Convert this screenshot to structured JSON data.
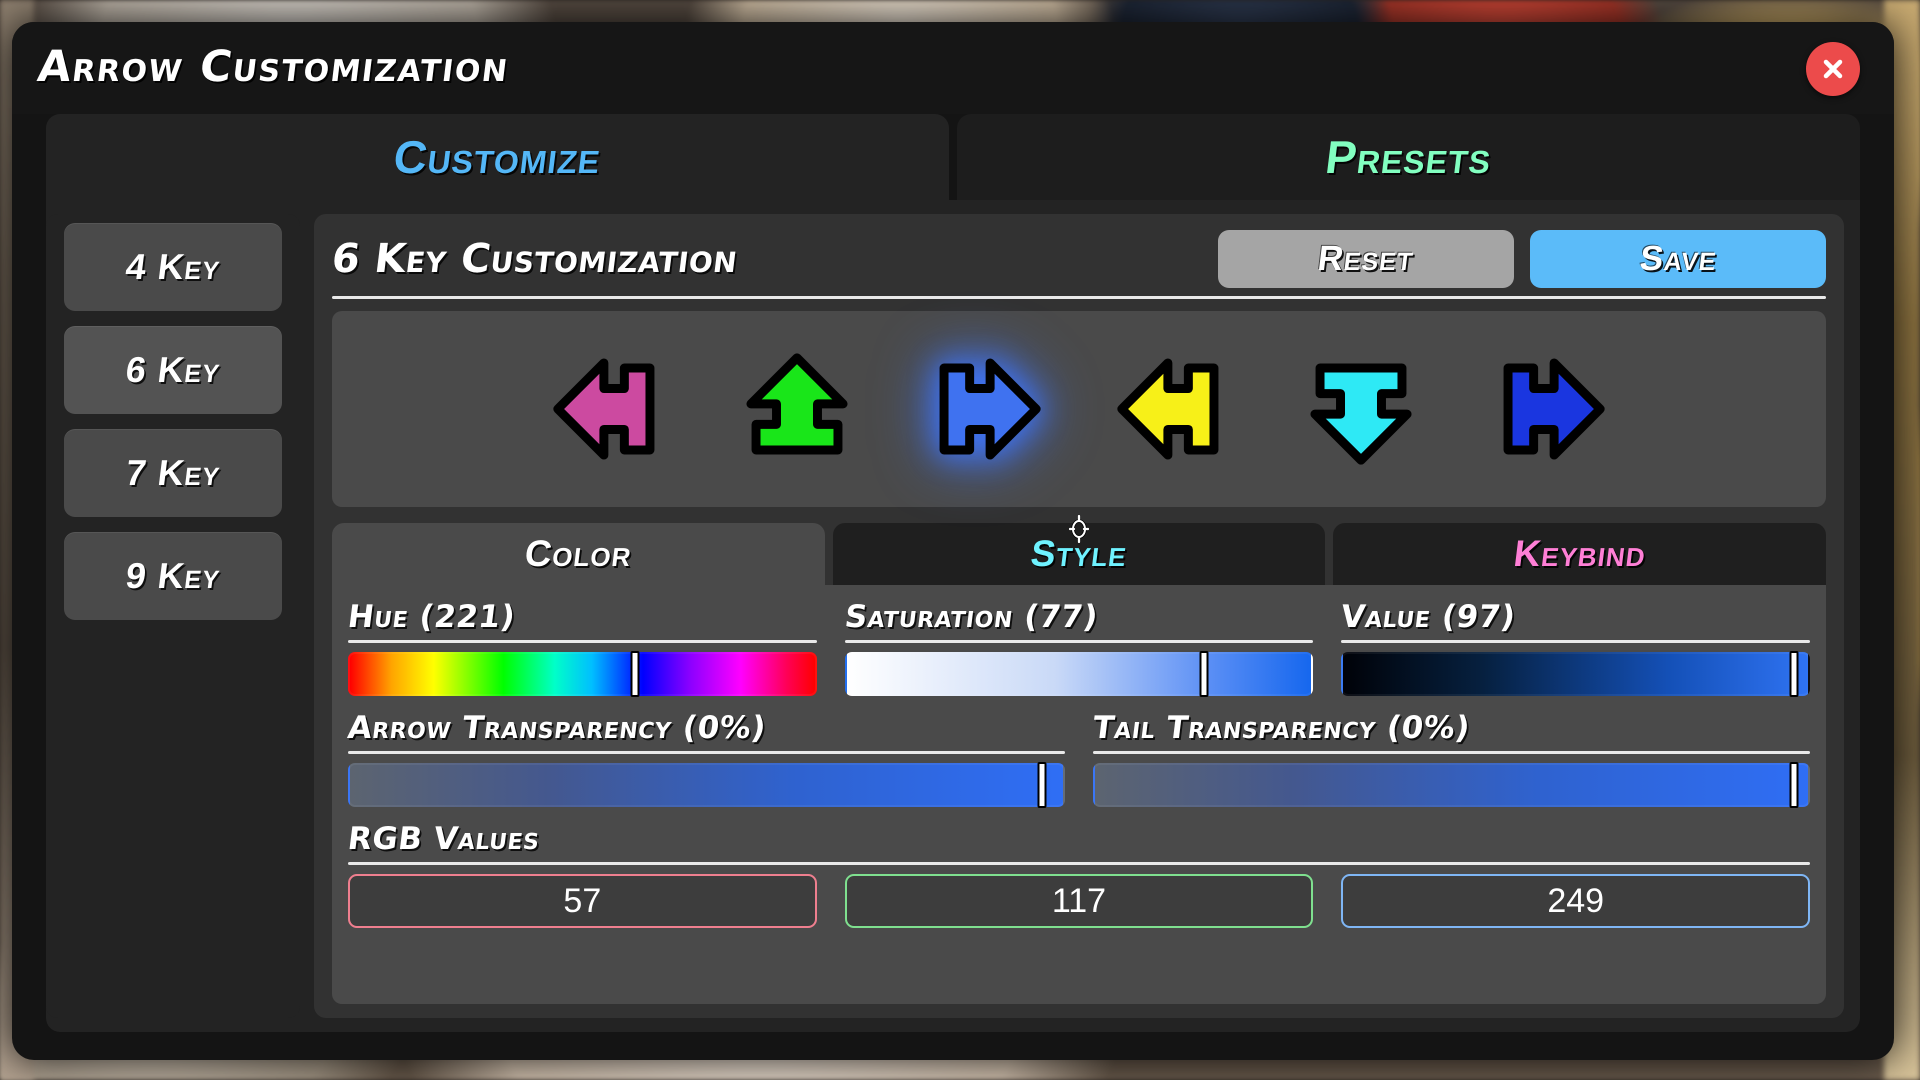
{
  "window": {
    "title": "Arrow Customization",
    "close_icon": "close-x-icon"
  },
  "top_tabs": [
    {
      "id": "customize",
      "label": "Customize",
      "color": "#54b7f7",
      "active": true
    },
    {
      "id": "presets",
      "label": "Presets",
      "color": "#82ffc0",
      "active": false
    }
  ],
  "sidebar": {
    "items": [
      {
        "label": "4 Key",
        "selected": false
      },
      {
        "label": "6 Key",
        "selected": true
      },
      {
        "label": "7 Key",
        "selected": false
      },
      {
        "label": "9 Key",
        "selected": false
      }
    ]
  },
  "panel": {
    "title": "6 Key Customization",
    "reset_label": "Reset",
    "save_label": "Save",
    "reset_color": "#a5a5a5",
    "save_color": "#5bbbf9"
  },
  "preview": {
    "arrows": [
      {
        "name": "arrow-left-magenta",
        "direction": "left",
        "color": "#cc4aa0",
        "selected": false
      },
      {
        "name": "arrow-up-green",
        "direction": "up",
        "color": "#19e619",
        "selected": false
      },
      {
        "name": "arrow-right-blue",
        "direction": "right",
        "color": "#3f72f0",
        "selected": true
      },
      {
        "name": "arrow-left-yellow",
        "direction": "left",
        "color": "#f7f018",
        "selected": false
      },
      {
        "name": "arrow-down-cyan",
        "direction": "down",
        "color": "#2ee9f5",
        "selected": false
      },
      {
        "name": "arrow-right-navy",
        "direction": "right",
        "color": "#1a36e0",
        "selected": false
      }
    ],
    "cursor_icon": "mouse-cursor-icon"
  },
  "sub_tabs": [
    {
      "id": "color",
      "label": "Color",
      "color": "#ffffff",
      "active": true
    },
    {
      "id": "style",
      "label": "Style",
      "color": "#6ff2ff",
      "active": false
    },
    {
      "id": "keybind",
      "label": "Keybind",
      "color": "#ff7fd6",
      "active": false
    }
  ],
  "sliders": {
    "hue": {
      "label": "Hue (221)",
      "value": 221,
      "max": 360,
      "percent": 61.4
    },
    "saturation": {
      "label": "Saturation (77)",
      "value": 77,
      "max": 100,
      "percent": 77
    },
    "value": {
      "label": "Value (97)",
      "value": 97,
      "max": 100,
      "percent": 97
    },
    "arrow_transparency": {
      "label": "Arrow Transparency (0%)",
      "value": 0,
      "max": 100,
      "percent": 97
    },
    "tail_transparency": {
      "label": "Tail Transparency (0%)",
      "value": 0,
      "max": 100,
      "percent": 98
    }
  },
  "rgb": {
    "label": "RGB Values",
    "r": "57",
    "g": "117",
    "b": "249",
    "r_border": "#ef7f8f",
    "g_border": "#7fe08f",
    "b_border": "#7fb6f5"
  }
}
